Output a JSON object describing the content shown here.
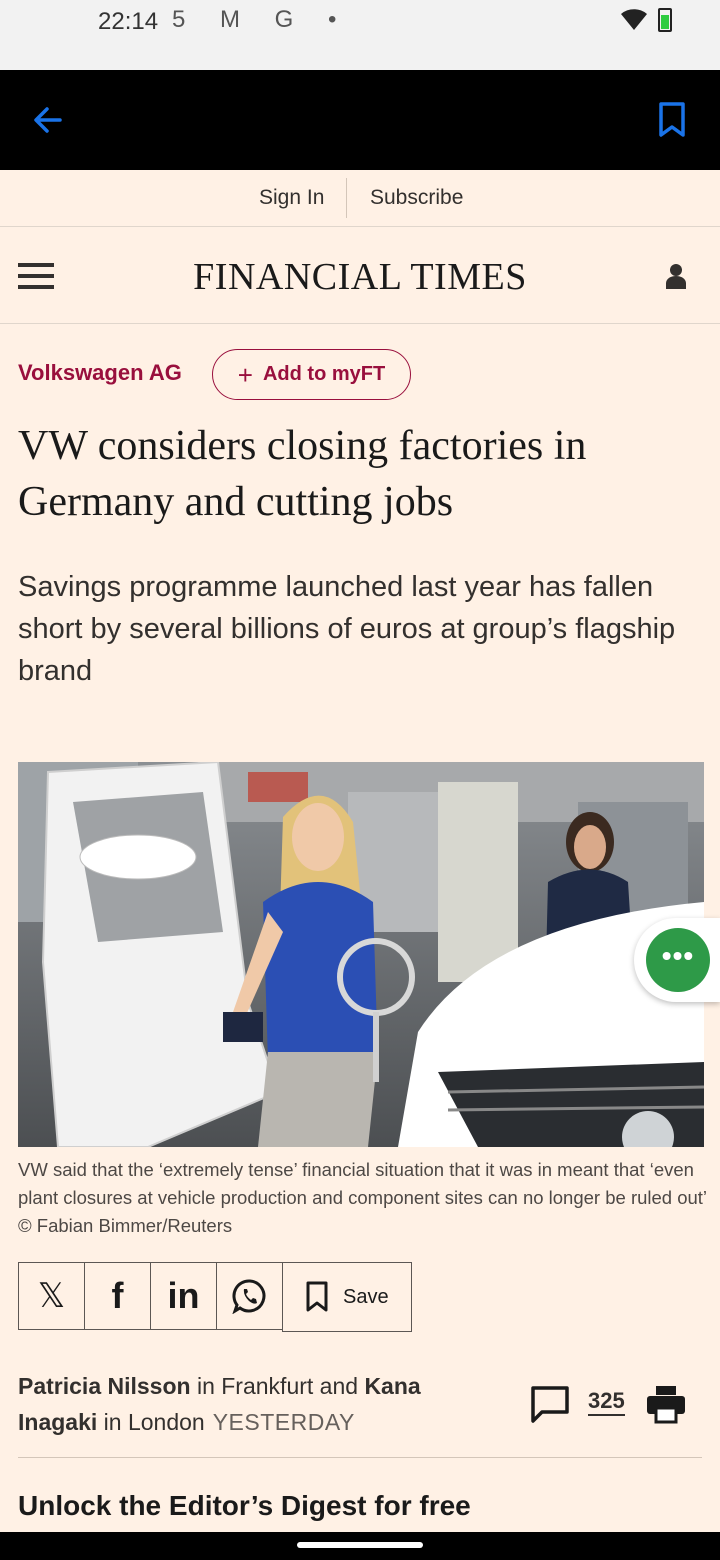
{
  "status": {
    "time": "22:14",
    "icons": "5 M G •"
  },
  "auth": {
    "sign_in": "Sign In",
    "subscribe": "Subscribe"
  },
  "masthead": {
    "logo": "FINANCIAL TIMES"
  },
  "article": {
    "topic": "Volkswagen AG",
    "add_myft": "Add to myFT",
    "headline": "VW considers closing factories in Germany and cutting jobs",
    "standfirst": "Savings programme launched last year has fallen short by several billions of euros at group’s flagship brand",
    "caption": "VW said that the ‘extremely tense’ financial situation that it was in meant that ‘even plant closures at vehicle production and component sites can no longer be ruled out’ © Fabian Bimmer/Reuters",
    "author1": "Patricia Nilsson",
    "location1": " in Frankfurt and ",
    "author2": "Kana Inagaki",
    "location2": " in London",
    "timestamp": "YESTERDAY",
    "comment_count": "325",
    "digest_heading": "Unlock the Editor’s Digest for free"
  },
  "share": {
    "x_label": "𝕏",
    "facebook_label": "f",
    "linkedin_label": "in",
    "save_label": "Save"
  },
  "colors": {
    "background": "#fff1e5",
    "claret": "#990f3d",
    "app_bar": "#000000",
    "fab": "#2e9a48",
    "accent_blue": "#1a73e8"
  }
}
